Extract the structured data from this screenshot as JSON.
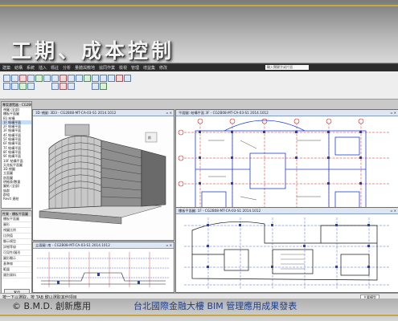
{
  "slide": {
    "title": "工期、成本控制",
    "caption_left": "© B.M.D. 創新應用",
    "caption_center": "台北國際金融大樓 BIM 管理應用成果發表"
  },
  "ribbon": {
    "tabs": [
      "建築",
      "結構",
      "系統",
      "插入",
      "標註",
      "分析",
      "量體與敷地",
      "協同作業",
      "檢視",
      "管理",
      "增益集",
      "修改"
    ],
    "search_placeholder": "輸入關鍵字或片語"
  },
  "browser": {
    "title": "專案瀏覽器 - CG2B08-MT-CA-03-S1",
    "items": [
      "視圖 (全部)",
      "樓板平面圖",
      "B1 結構",
      "1F 結構平面",
      "2F 結構平面",
      "3F 結構平面",
      "4F 結構平面",
      "5F 結構平面",
      "6F 結構平面",
      "7F 結構平面",
      "8F 結構平面",
      "9F 結構平面",
      "10F 結構平面",
      "天花板平面圖",
      "3D 視圖",
      "立面圖",
      "剖面圖",
      "明細表/數量",
      "圖紙 (全部)",
      "族群",
      "群組",
      "Revit 連結"
    ]
  },
  "properties": {
    "title": "性質 - 樓板平面圖",
    "rows": [
      "樓板平面圖",
      "圖形",
      "視圖比例",
      "比例值",
      "顯示模型",
      "詳細等級",
      "可見性/圖形",
      "圖形顯示",
      "基準線",
      "範圍",
      "識別資料"
    ],
    "apply": "套用"
  },
  "views": {
    "v3d": "3D 視圖: 3D3 - CG2B08-MT-CA-03-S1 2014.1012",
    "plan1": "平面圖: 結構平面 3F - CG2B08-MT-CA-03-S1 2014.1012",
    "elev": "立面圖: 南 - CG2B08-MT-CA-03-S1 2014.1012",
    "plan2": "樓板平面圖: 1F - CG2B08-MT-CA-03-S1 2014.1012"
  },
  "status": {
    "text": "按一下以選取，按 TAB 鍵以選取其他項目",
    "model": "主要模型"
  },
  "colors": {
    "accent_gold": "#c9a640",
    "blue_lines": "#1f3fd1",
    "red_grid": "#d21f1f"
  }
}
